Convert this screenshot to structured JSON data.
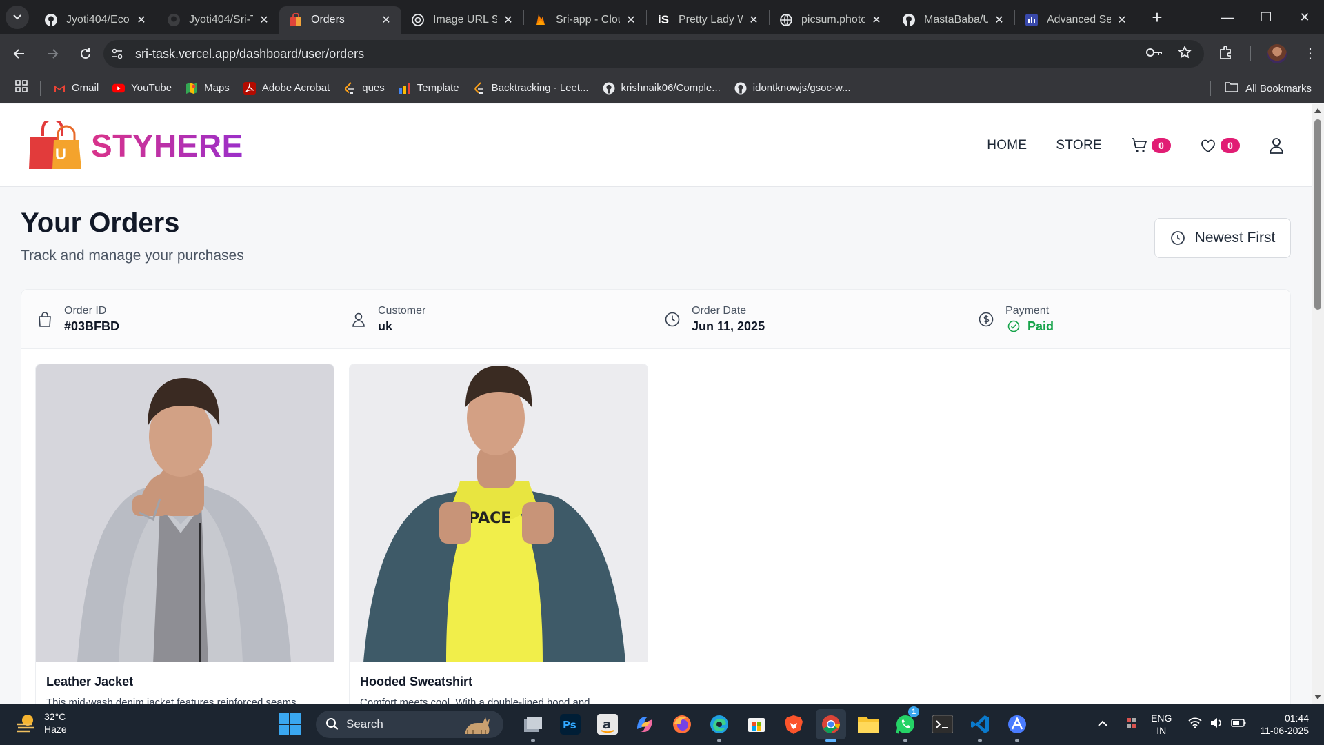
{
  "browser": {
    "tabs": [
      {
        "title": "Jyoti404/Ecom",
        "icon": "github-icon",
        "active": false
      },
      {
        "title": "Jyoti404/Sri-T",
        "icon": "github-icon",
        "active": false
      },
      {
        "title": "Orders",
        "icon": "shopping-bag-icon",
        "active": true
      },
      {
        "title": "Image URL Sc",
        "icon": "globe-icon",
        "active": false
      },
      {
        "title": "Sri-app - Clou",
        "icon": "firebase-icon",
        "active": false
      },
      {
        "title": "Pretty Lady W",
        "icon": "istock-icon",
        "active": false
      },
      {
        "title": "picsum.photo",
        "icon": "globe-icon",
        "active": false
      },
      {
        "title": "MastaBaba/U",
        "icon": "github-icon",
        "active": false
      },
      {
        "title": "Advanced Se",
        "icon": "advanced-search-icon",
        "active": false
      }
    ],
    "url": "sri-task.vercel.app/dashboard/user/orders",
    "bookmarks": [
      {
        "label": "Gmail",
        "icon": "gmail-icon"
      },
      {
        "label": "YouTube",
        "icon": "youtube-icon"
      },
      {
        "label": "Maps",
        "icon": "maps-icon"
      },
      {
        "label": "Adobe Acrobat",
        "icon": "acrobat-icon"
      },
      {
        "label": "ques",
        "icon": "leetcode-icon"
      },
      {
        "label": "Template",
        "icon": "chart-icon"
      },
      {
        "label": "Backtracking - Leet...",
        "icon": "leetcode-icon"
      },
      {
        "label": "krishnaik06/Comple...",
        "icon": "github-icon"
      },
      {
        "label": "idontknowjs/gsoc-w...",
        "icon": "github-icon"
      }
    ],
    "all_bookmarks": "All Bookmarks"
  },
  "site": {
    "brand": "STYHERE",
    "logo_letter": "U",
    "nav": {
      "home": "HOME",
      "store": "STORE",
      "cart_count": "0",
      "wishlist_count": "0"
    }
  },
  "orders_page": {
    "title": "Your Orders",
    "subtitle": "Track and manage your purchases",
    "sort_label": "Newest First",
    "order": {
      "id_label": "Order ID",
      "id": "#03BFBD",
      "customer_label": "Customer",
      "customer": "uk",
      "date_label": "Order Date",
      "date": "Jun 11, 2025",
      "payment_label": "Payment",
      "payment": "Paid"
    },
    "products": [
      {
        "name": "Leather Jacket",
        "description": "This mid-wash denim jacket features reinforced seams"
      },
      {
        "name": "Hooded Sweatshirt",
        "description": "Comfort meets cool. With a double-lined hood and"
      }
    ],
    "hoodie_print": "PACE"
  },
  "taskbar": {
    "temperature": "32°C",
    "weather": "Haze",
    "search": "Search",
    "lang_top": "ENG",
    "lang_bottom": "IN",
    "time": "01:44",
    "date": "11-06-2025",
    "whatsapp_badge": "1"
  },
  "colors": {
    "brand_gradient_start": "#d9338a",
    "brand_gradient_end": "#9b2fc9",
    "badge": "#e11d74",
    "paid": "#16a34a"
  }
}
